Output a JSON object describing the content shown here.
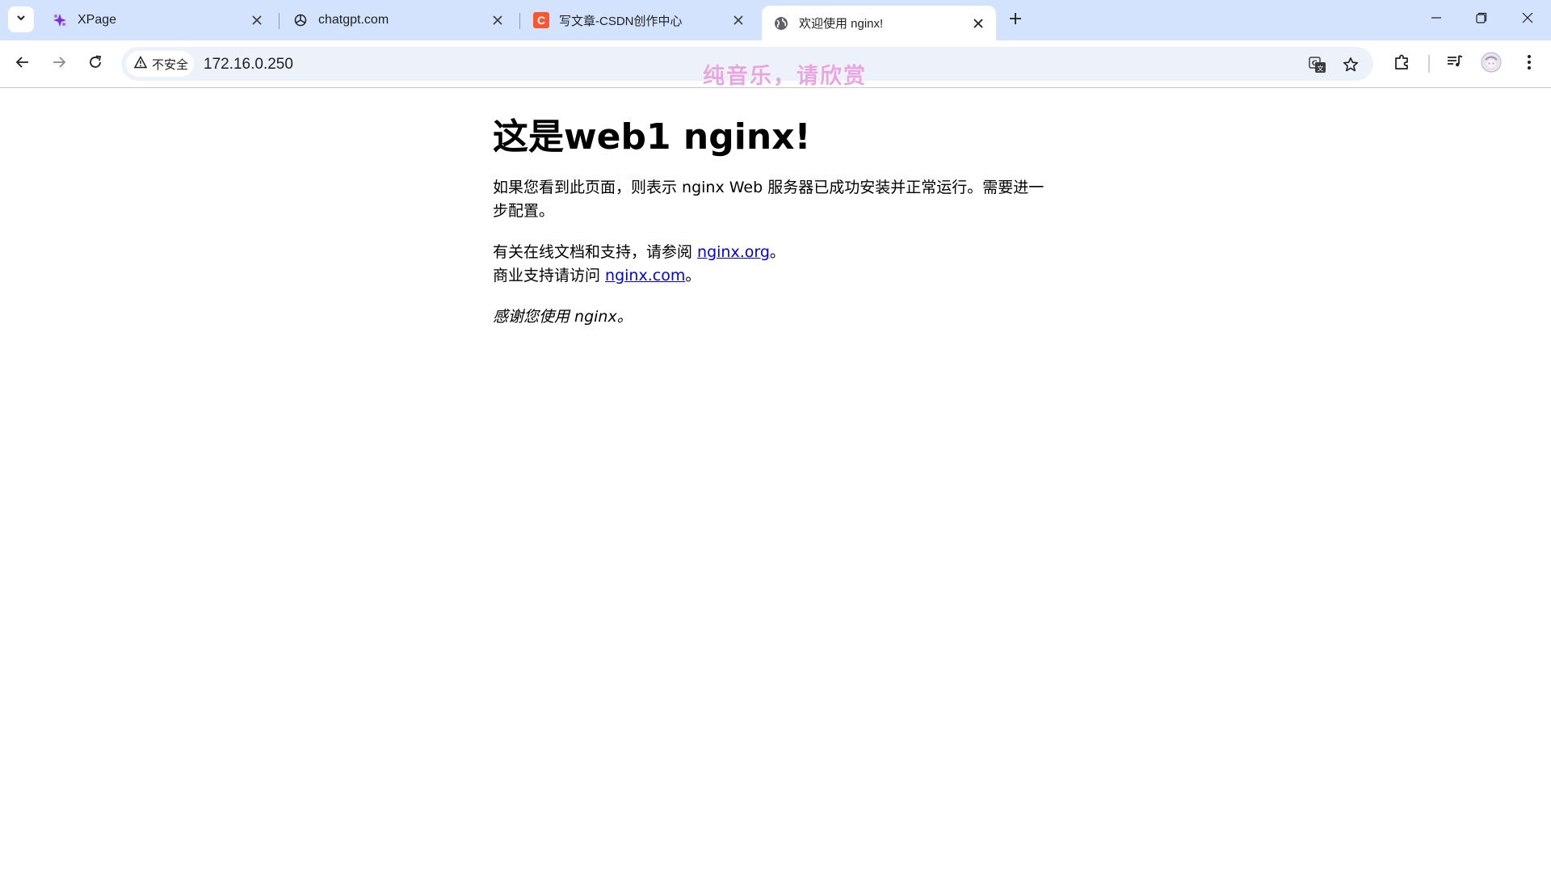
{
  "browser": {
    "tabs": [
      {
        "title": "XPage",
        "favicon": "xpage-icon",
        "active": false
      },
      {
        "title": "chatgpt.com",
        "favicon": "openai-icon",
        "active": false
      },
      {
        "title": "写文章-CSDN创作中心",
        "favicon": "csdn-icon",
        "active": false
      },
      {
        "title": "欢迎使用 nginx!",
        "favicon": "globe-icon",
        "active": true
      }
    ],
    "address_bar": {
      "security_label": "不安全",
      "url": "172.16.0.250"
    },
    "overlay_text": "纯音乐，请欣赏",
    "colors": {
      "tabstrip": "#d3e3fd",
      "omnibox": "#edf2fa",
      "csdn_brand": "#fc5531",
      "xpage_brand": "#7b2fd6",
      "overlay": "#e7a6e2"
    }
  },
  "page": {
    "heading": "这是web1 nginx!",
    "intro": "如果您看到此页面，则表示 nginx Web 服务器已成功安装并正常运行。需要进一步配置。",
    "docs_prefix": "有关在线文档和支持，请参阅 ",
    "docs_link": "nginx.org",
    "docs_suffix": "。",
    "commercial_prefix": "商业支持请访问 ",
    "commercial_link": "nginx.com",
    "commercial_suffix": "。",
    "thanks": "感谢您使用 nginx。"
  }
}
